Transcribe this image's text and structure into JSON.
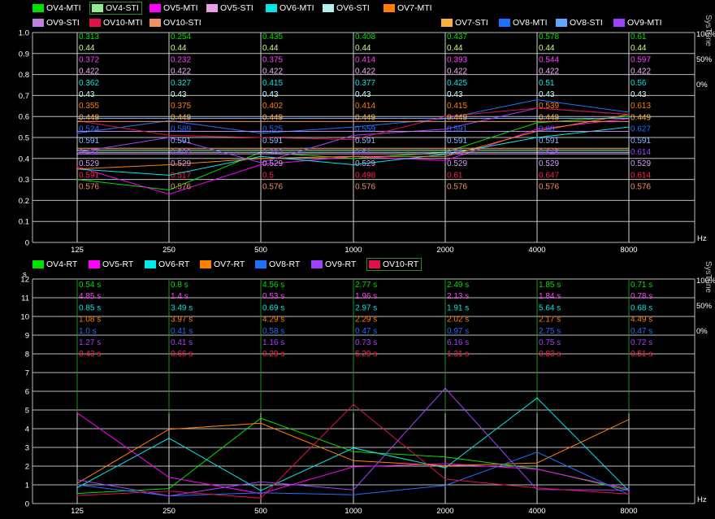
{
  "window": {
    "right_title_top": "SysTune",
    "right_title_bottom": "SysTune"
  },
  "x_unit": "Hz",
  "chart_data": [
    {
      "type": "line",
      "x": [
        "125",
        "250",
        "500",
        "1000",
        "2000",
        "4000",
        "8000"
      ],
      "ylim": [
        0,
        1.0
      ],
      "yticks": [
        "0",
        "0.1",
        "0.2",
        "0.3",
        "0.4",
        "0.5",
        "0.6",
        "0.7",
        "0.8",
        "0.9",
        "1.0"
      ],
      "ylabel": "",
      "right_ticks": [
        "100%",
        "50%",
        "0%"
      ],
      "legend": [
        {
          "name": "OV4-MTI",
          "color": "#00e000"
        },
        {
          "name": "OV4-STI",
          "color": "#90ee90",
          "selected": true
        },
        {
          "name": "OV5-MTI",
          "color": "#ff00ff"
        },
        {
          "name": "OV5-STI",
          "color": "#e8a0e8"
        },
        {
          "name": "OV6-MTI",
          "color": "#00e8e8"
        },
        {
          "name": "OV6-STI",
          "color": "#b0f0f0"
        },
        {
          "name": "OV7-MTI",
          "color": "#ff8000"
        },
        {
          "name": "OV7-STI",
          "color": "#ffb040"
        },
        {
          "name": "OV8-MTI",
          "color": "#1e70ff"
        },
        {
          "name": "OV8-STI",
          "color": "#60a8ff"
        },
        {
          "name": "OV9-MTI",
          "color": "#a040ff"
        },
        {
          "name": "OV9-STI",
          "color": "#c080e0"
        },
        {
          "name": "OV10-MTI",
          "color": "#e0104a"
        },
        {
          "name": "OV10-STI",
          "color": "#f09060"
        }
      ],
      "label_rows": [
        {
          "color": "#00e000",
          "values": [
            "0.313",
            "0.254",
            "0.435",
            "0.408",
            "0.437",
            "0.578",
            "0.61"
          ]
        },
        {
          "color": "#c8ff80",
          "values": [
            "0.44",
            "0.44",
            "0.44",
            "0.44",
            "0.44",
            "0.44",
            "0.44"
          ]
        },
        {
          "color": "#ff40ff",
          "values": [
            "0.372",
            "0.232",
            "0.375",
            "0.414",
            "0.393",
            "0.544",
            "0.597"
          ]
        },
        {
          "color": "#f0b0f0",
          "values": [
            "0.422",
            "0.422",
            "0.422",
            "0.422",
            "0.422",
            "0.422",
            "0.422"
          ]
        },
        {
          "color": "#00e8e8",
          "values": [
            "0.362",
            "0.327",
            "0.415",
            "0.377",
            "0.425",
            "0.51",
            "0.56"
          ]
        },
        {
          "color": "#d0ffff",
          "values": [
            "0.43",
            "0.43",
            "0.43",
            "0.43",
            "0.43",
            "0.43",
            "0.43"
          ]
        },
        {
          "color": "#ff8000",
          "values": [
            "0.355",
            "0.375",
            "0.402",
            "0.414",
            "0.415",
            "0.539",
            "0.613"
          ]
        },
        {
          "color": "#ffb040",
          "values": [
            "0.449",
            "0.449",
            "0.449",
            "0.449",
            "0.449",
            "0.449",
            "0.449"
          ]
        },
        {
          "color": "#1e70ff",
          "values": [
            "0.524",
            "0.589",
            "0.525",
            "0.559",
            "0.591",
            "0.68",
            "0.627"
          ]
        },
        {
          "color": "#80b8ff",
          "values": [
            "0.591",
            "0.591",
            "0.591",
            "0.591",
            "0.591",
            "0.591",
            "0.591"
          ]
        },
        {
          "color": "#a040ff",
          "values": [
            "0.431",
            "0.509",
            "0.382",
            "0.51",
            "0.54",
            "0.645",
            "0.614"
          ]
        },
        {
          "color": "#d0a0f0",
          "values": [
            "0.529",
            "0.529",
            "0.529",
            "0.529",
            "0.529",
            "0.529",
            "0.529"
          ]
        },
        {
          "color": "#ff2050",
          "values": [
            "0.591",
            "0.517",
            "0.5",
            "0.498",
            "0.61",
            "0.647",
            "0.614"
          ]
        },
        {
          "color": "#f09060",
          "values": [
            "0.576",
            "0.576",
            "0.576",
            "0.576",
            "0.576",
            "0.576",
            "0.576"
          ]
        }
      ],
      "series": [
        {
          "name": "OV4-MTI",
          "color": "#00e000",
          "values": [
            0.3,
            0.25,
            0.43,
            0.4,
            0.43,
            0.57,
            0.6
          ]
        },
        {
          "name": "OV4-STI",
          "color": "#90ee90",
          "values": [
            0.44,
            0.44,
            0.44,
            0.44,
            0.44,
            0.44,
            0.44
          ]
        },
        {
          "name": "OV5-MTI",
          "color": "#ff00ff",
          "values": [
            0.36,
            0.23,
            0.37,
            0.41,
            0.39,
            0.54,
            0.59
          ]
        },
        {
          "name": "OV5-STI",
          "color": "#e8a0e8",
          "values": [
            0.422,
            0.422,
            0.422,
            0.422,
            0.422,
            0.422,
            0.422
          ]
        },
        {
          "name": "OV6-MTI",
          "color": "#00e8e8",
          "values": [
            0.35,
            0.32,
            0.41,
            0.37,
            0.42,
            0.5,
            0.55
          ]
        },
        {
          "name": "OV6-STI",
          "color": "#b0f0f0",
          "values": [
            0.43,
            0.43,
            0.43,
            0.43,
            0.43,
            0.43,
            0.43
          ]
        },
        {
          "name": "OV7-MTI",
          "color": "#ff8000",
          "values": [
            0.35,
            0.37,
            0.4,
            0.41,
            0.41,
            0.53,
            0.61
          ]
        },
        {
          "name": "OV7-STI",
          "color": "#ffb040",
          "values": [
            0.449,
            0.449,
            0.449,
            0.449,
            0.449,
            0.449,
            0.449
          ]
        },
        {
          "name": "OV8-MTI",
          "color": "#1e70ff",
          "values": [
            0.52,
            0.58,
            0.52,
            0.55,
            0.59,
            0.68,
            0.62
          ]
        },
        {
          "name": "OV8-STI",
          "color": "#60a8ff",
          "values": [
            0.591,
            0.591,
            0.591,
            0.591,
            0.591,
            0.591,
            0.591
          ]
        },
        {
          "name": "OV9-MTI",
          "color": "#a040ff",
          "values": [
            0.43,
            0.5,
            0.38,
            0.51,
            0.54,
            0.64,
            0.61
          ]
        },
        {
          "name": "OV9-STI",
          "color": "#c080e0",
          "values": [
            0.529,
            0.529,
            0.529,
            0.529,
            0.529,
            0.529,
            0.529
          ]
        },
        {
          "name": "OV10-MTI",
          "color": "#e0104a",
          "values": [
            0.58,
            0.51,
            0.5,
            0.49,
            0.6,
            0.64,
            0.61
          ]
        },
        {
          "name": "OV10-STI",
          "color": "#f09060",
          "values": [
            0.576,
            0.576,
            0.576,
            0.576,
            0.576,
            0.576,
            0.576
          ]
        }
      ]
    },
    {
      "type": "line",
      "x": [
        "125",
        "250",
        "500",
        "1000",
        "2000",
        "4000",
        "8000"
      ],
      "ylim": [
        0,
        12
      ],
      "yticks": [
        "0",
        "1",
        "2",
        "3",
        "4",
        "5",
        "6",
        "7",
        "8",
        "9",
        "10",
        "11",
        "12"
      ],
      "ylabel": "s",
      "right_ticks": [
        "100%",
        "50%",
        "0%"
      ],
      "legend": [
        {
          "name": "OV4-RT",
          "color": "#00e000"
        },
        {
          "name": "OV5-RT",
          "color": "#ff00ff"
        },
        {
          "name": "OV6-RT",
          "color": "#00e8e8"
        },
        {
          "name": "OV7-RT",
          "color": "#ff8000"
        },
        {
          "name": "OV8-RT",
          "color": "#1e70ff"
        },
        {
          "name": "OV9-RT",
          "color": "#a040ff"
        },
        {
          "name": "OV10-RT",
          "color": "#e0104a",
          "selected": true
        }
      ],
      "label_rows": [
        {
          "color": "#00e000",
          "values": [
            "0.54 s",
            "0.8 s",
            "4.56 s",
            "2.77 s",
            "2.49 s",
            "1.85 s",
            "0.71 s"
          ]
        },
        {
          "color": "#ff40ff",
          "values": [
            "4.85 s",
            "1.4 s",
            "0.53 s",
            "1.96 s",
            "2.13 s",
            "1.84 s",
            "0.78 s"
          ]
        },
        {
          "color": "#00e8e8",
          "values": [
            "0.85 s",
            "3.49 s",
            "0.69 s",
            "2.97 s",
            "1.91 s",
            "5.64 s",
            "0.68 s"
          ]
        },
        {
          "color": "#ff8000",
          "values": [
            "1.08 s",
            "3.97 s",
            "4.29 s",
            "2.29 s",
            "2.02 s",
            "2.17 s",
            "4.49 s"
          ]
        },
        {
          "color": "#1e70ff",
          "values": [
            "1.0 s",
            "0.41 s",
            "0.58 s",
            "0.47 s",
            "0.97 s",
            "2.75 s",
            "0.47 s"
          ]
        },
        {
          "color": "#a040ff",
          "values": [
            "1.27 s",
            "0.41 s",
            "1.16 s",
            "0.73 s",
            "6.16 s",
            "0.75 s",
            "0.72 s"
          ]
        },
        {
          "color": "#ff2050",
          "values": [
            "0.43 s",
            "0.66 s",
            "0.29 s",
            "5.29 s",
            "1.31 s",
            "0.83 s",
            "0.51 s"
          ]
        }
      ],
      "series": [
        {
          "name": "OV4-RT",
          "color": "#00e000",
          "values": [
            0.54,
            0.8,
            4.56,
            2.77,
            2.49,
            1.85,
            0.71
          ]
        },
        {
          "name": "OV5-RT",
          "color": "#ff00ff",
          "values": [
            4.85,
            1.4,
            0.53,
            1.96,
            2.13,
            1.84,
            0.78
          ]
        },
        {
          "name": "OV6-RT",
          "color": "#00e8e8",
          "values": [
            0.85,
            3.49,
            0.69,
            2.97,
            1.91,
            5.64,
            0.68
          ]
        },
        {
          "name": "OV7-RT",
          "color": "#ff8000",
          "values": [
            1.08,
            3.97,
            4.29,
            2.29,
            2.02,
            2.17,
            4.49
          ]
        },
        {
          "name": "OV8-RT",
          "color": "#1e70ff",
          "values": [
            1.0,
            0.41,
            0.58,
            0.47,
            0.97,
            2.75,
            0.47
          ]
        },
        {
          "name": "OV9-RT",
          "color": "#a040ff",
          "values": [
            1.27,
            0.41,
            1.16,
            0.73,
            6.16,
            0.75,
            0.72
          ]
        },
        {
          "name": "OV10-RT",
          "color": "#e0104a",
          "values": [
            0.43,
            0.66,
            0.29,
            5.29,
            1.31,
            0.83,
            0.51
          ]
        }
      ]
    }
  ]
}
